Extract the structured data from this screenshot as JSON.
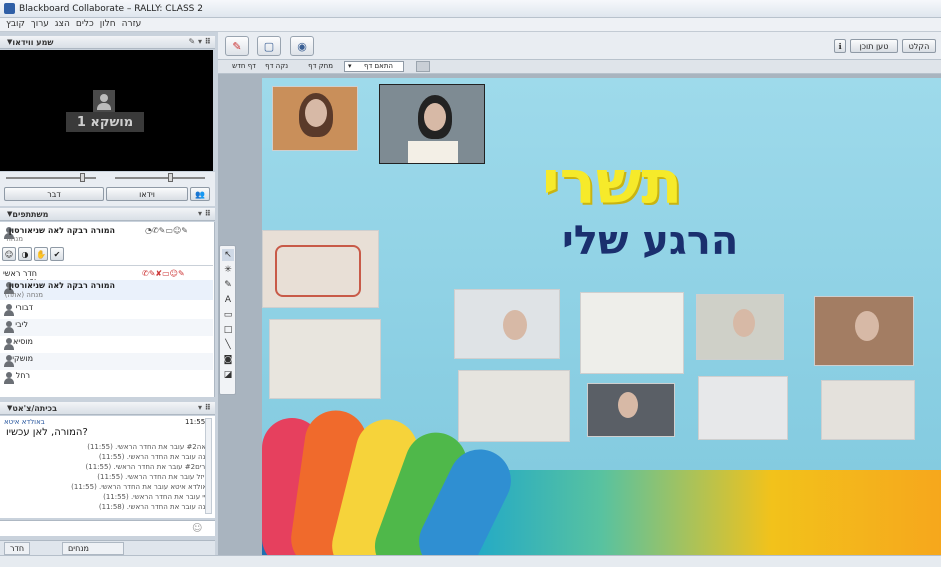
{
  "window": {
    "title": "Blackboard Collaborate – RALLY: CLASS 2"
  },
  "menu": {
    "items": [
      "עזרה",
      "חלון",
      "כלים",
      "הצג",
      "ערוך",
      "קובץ"
    ]
  },
  "video_panel": {
    "header": "שמע ווידאו",
    "caption": "מושקא 1",
    "talk_label": "דבר",
    "video_label": "וידאו"
  },
  "participants_panel": {
    "header": "משתתפים",
    "moderator": {
      "name": "המורה רבקה לאה שניאורסון",
      "role": "מנחה"
    },
    "room_label": "חדר ראשי (6)",
    "room_moderator": {
      "name": "המורה רבקה לאה שניאורסון",
      "role": "מנחה (אתה)"
    },
    "users": [
      "דבורי",
      "ליבי",
      "מוסיא",
      "מושקי",
      "רחל"
    ]
  },
  "chat_panel": {
    "header": "בכיתה/צ'אט",
    "time": "11:55",
    "sender": "באולדא איטא",
    "message": "?המורה, לאן עכשיו",
    "lines": [
      "לאה#2 עובר את החדר הראשי. (11:55)",
      "חנה עובר את החדר הראשי. (11:55)",
      "מרים#2 עובר את החדר הראשי. (11:55)",
      "רייזל עובר את החדר הראשי. (11:55)",
      "גאולדא איטא עובר את החדר הראשי. (11:55)",
      "חיי עובר את החדר הראשי. (11:55)",
      "חנה עובר את החדר הראשי. (11:58)"
    ]
  },
  "bottom_tabs": {
    "room": "חדר",
    "moderators": "מנחים"
  },
  "content_toolbar": {
    "load_content": "טען תוכן",
    "leave": "הקלט"
  },
  "content_subbar": {
    "new_page": "דף חדש",
    "clear_page": "נקה דף",
    "erase_page": "מחק דף",
    "fit_page": "התאם דף"
  },
  "slide": {
    "title": "תשרי",
    "subtitle": "הרגע שלי"
  },
  "colors": {
    "accent": "#3a5f94",
    "yellow": "#f6ea2a",
    "navy": "#1a2f6e"
  }
}
